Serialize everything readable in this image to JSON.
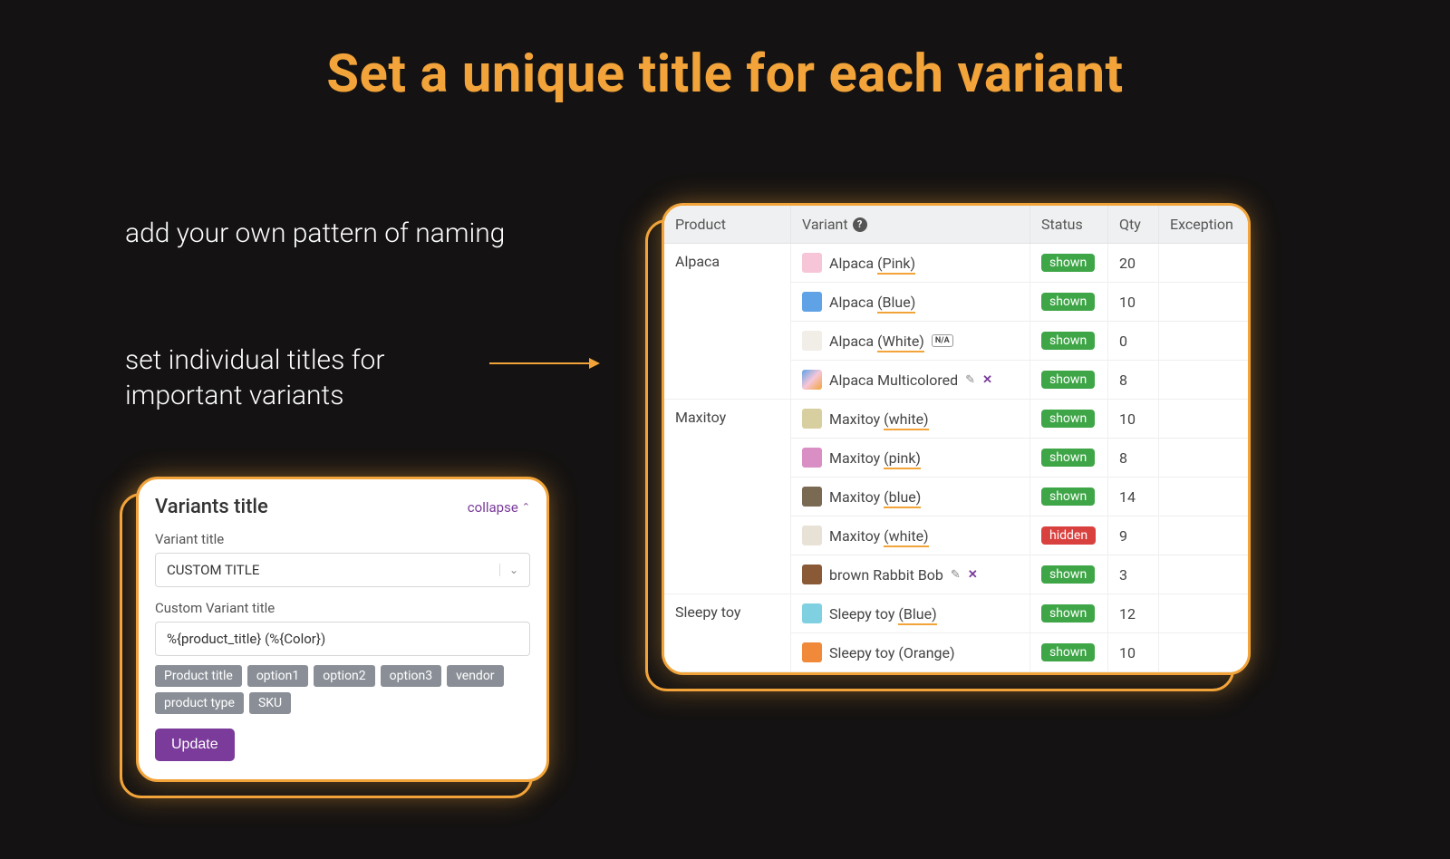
{
  "page": {
    "title": "Set a unique title for each variant",
    "subtitle1": "add your own pattern of naming",
    "subtitle2": "set individual titles for important variants"
  },
  "panel": {
    "heading": "Variants title",
    "collapse": "collapse",
    "variant_title_label": "Variant title",
    "select_value": "CUSTOM TITLE",
    "custom_title_label": "Custom Variant title",
    "custom_title_value": "%{product_title} (%{Color})",
    "chips": [
      "Product title",
      "option1",
      "option2",
      "option3",
      "vendor",
      "product type",
      "SKU"
    ],
    "update": "Update"
  },
  "table": {
    "headers": {
      "product": "Product",
      "variant": "Variant",
      "status": "Status",
      "qty": "Qty",
      "exception": "Exception"
    },
    "products": [
      {
        "name": "Alpaca",
        "rows": [
          {
            "thumb": "#f6c6d8",
            "prefix": "Alpaca ",
            "underline": "(Pink)",
            "na": false,
            "editable": false,
            "status": "shown",
            "qty": "20"
          },
          {
            "thumb": "#5fa3e6",
            "prefix": "Alpaca ",
            "underline": "(Blue)",
            "na": false,
            "editable": false,
            "status": "shown",
            "qty": "10"
          },
          {
            "thumb": "#f1eee8",
            "prefix": "Alpaca ",
            "underline": "(White)",
            "na": true,
            "editable": false,
            "status": "shown",
            "qty": "0"
          },
          {
            "thumb": "linear-gradient(135deg,#5fa3e6,#f6c6d8,#f2a43a)",
            "prefix": "Alpaca Multicolored",
            "underline": "",
            "na": false,
            "editable": true,
            "status": "shown",
            "qty": "8"
          }
        ]
      },
      {
        "name": "Maxitoy",
        "rows": [
          {
            "thumb": "#d8cfa0",
            "prefix": " Maxitoy ",
            "underline": "(white)",
            "na": false,
            "editable": false,
            "status": "shown",
            "qty": "10"
          },
          {
            "thumb": "#d98fc4",
            "prefix": " Maxitoy ",
            "underline": "(pink)",
            "na": false,
            "editable": false,
            "status": "shown",
            "qty": "8"
          },
          {
            "thumb": "#7a6a54",
            "prefix": " Maxitoy ",
            "underline": "(blue)",
            "na": false,
            "editable": false,
            "status": "shown",
            "qty": "14"
          },
          {
            "thumb": "#e8e2d6",
            "prefix": "Maxitoy ",
            "underline": "(white)",
            "na": false,
            "editable": false,
            "status": "hidden",
            "qty": "9"
          },
          {
            "thumb": "#8a5a36",
            "prefix": "brown Rabbit Bob",
            "underline": "",
            "na": false,
            "editable": true,
            "status": "shown",
            "qty": "3"
          }
        ]
      },
      {
        "name": "Sleepy toy",
        "rows": [
          {
            "thumb": "#7fd0e0",
            "prefix": "Sleepy toy ",
            "underline": "(Blue)",
            "na": false,
            "editable": false,
            "status": "shown",
            "qty": "12"
          },
          {
            "thumb": "#f08a3a",
            "prefix": "Sleepy toy (Orange)",
            "underline": "",
            "na": false,
            "editable": false,
            "status": "shown",
            "qty": "10"
          }
        ]
      }
    ]
  }
}
